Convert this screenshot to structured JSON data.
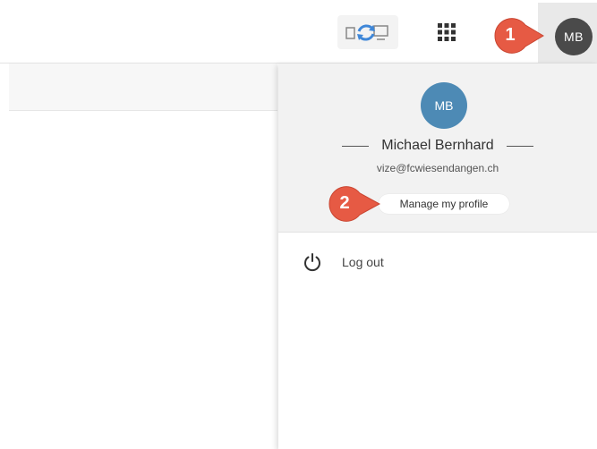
{
  "header": {
    "sync_icon": "device-sync-icon",
    "apps_icon": "app-grid-icon",
    "avatar_initials": "MB"
  },
  "callouts": [
    "1",
    "2"
  ],
  "profile_menu": {
    "avatar_initials": "MB",
    "name": "Michael Bernhard",
    "email": "vize@fcwiesendangen.ch",
    "manage_label": "Manage my profile",
    "logout_label": "Log out",
    "logout_icon": "power-icon"
  },
  "colors": {
    "callout": "#e65a44",
    "profile_avatar": "#4d8ab5",
    "header_avatar": "#4a4a4a",
    "sync_blue": "#3f87d8"
  }
}
